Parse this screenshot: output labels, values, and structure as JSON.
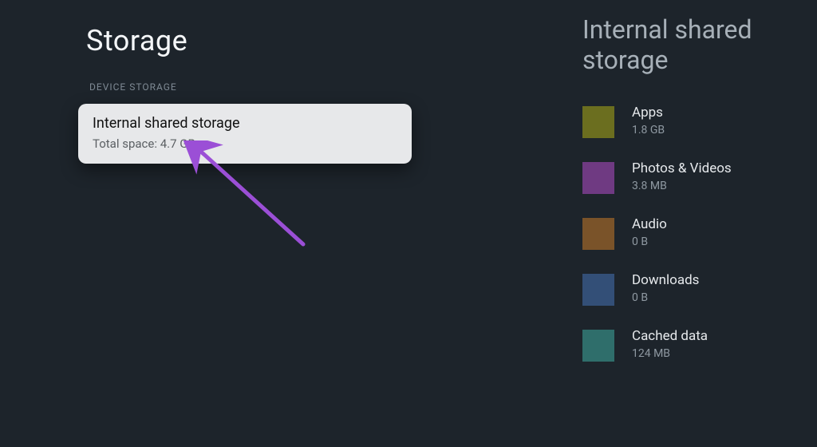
{
  "page": {
    "title": "Storage",
    "section_label": "DEVICE STORAGE",
    "card": {
      "title": "Internal shared storage",
      "subtitle": "Total space: 4.7 GB"
    }
  },
  "detail": {
    "title": "Internal shared storage",
    "categories": [
      {
        "label": "Apps",
        "size": "1.8 GB",
        "color": "#6b6e1f"
      },
      {
        "label": "Photos & Videos",
        "size": "3.8 MB",
        "color": "#6f3a82"
      },
      {
        "label": "Audio",
        "size": "0 B",
        "color": "#7a5329"
      },
      {
        "label": "Downloads",
        "size": "0 B",
        "color": "#334f77"
      },
      {
        "label": "Cached data",
        "size": "124 MB",
        "color": "#2f6e6b"
      }
    ]
  },
  "annotation": {
    "arrow_color": "#9b4fd6"
  }
}
